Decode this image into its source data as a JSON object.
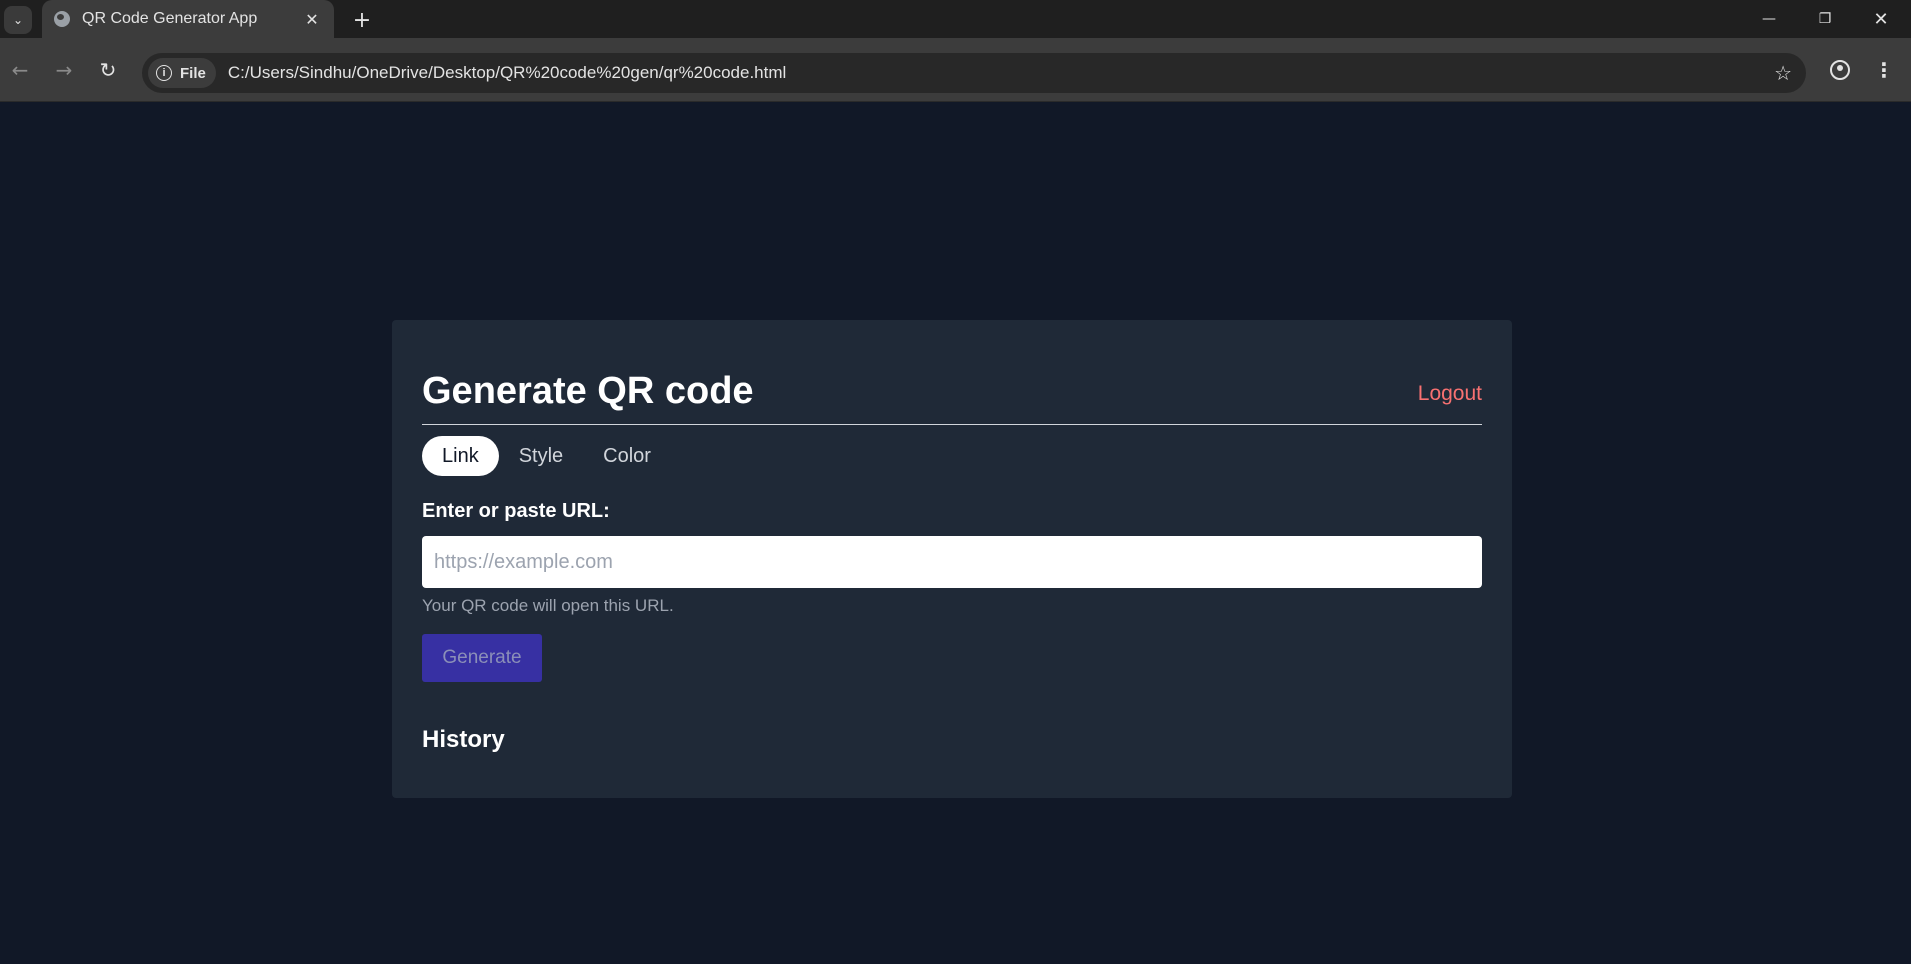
{
  "browser": {
    "tab_title": "QR Code Generator App",
    "new_tab_symbol": "+",
    "address_chip": "File",
    "url": "C:/Users/Sindhu/OneDrive/Desktop/QR%20code%20gen/qr%20code.html"
  },
  "page": {
    "title": "Generate QR code",
    "logout_label": "Logout",
    "tabs": [
      {
        "label": "Link",
        "active": true
      },
      {
        "label": "Style",
        "active": false
      },
      {
        "label": "Color",
        "active": false
      }
    ],
    "url_field": {
      "label": "Enter or paste URL:",
      "value": "",
      "placeholder": "https://example.com",
      "hint": "Your QR code will open this URL."
    },
    "generate_label": "Generate",
    "history_heading": "History"
  },
  "colors": {
    "page_bg": "#111827",
    "card_bg": "#1f2937",
    "logout": "#f87171",
    "generate_bg": "#3730a3"
  }
}
